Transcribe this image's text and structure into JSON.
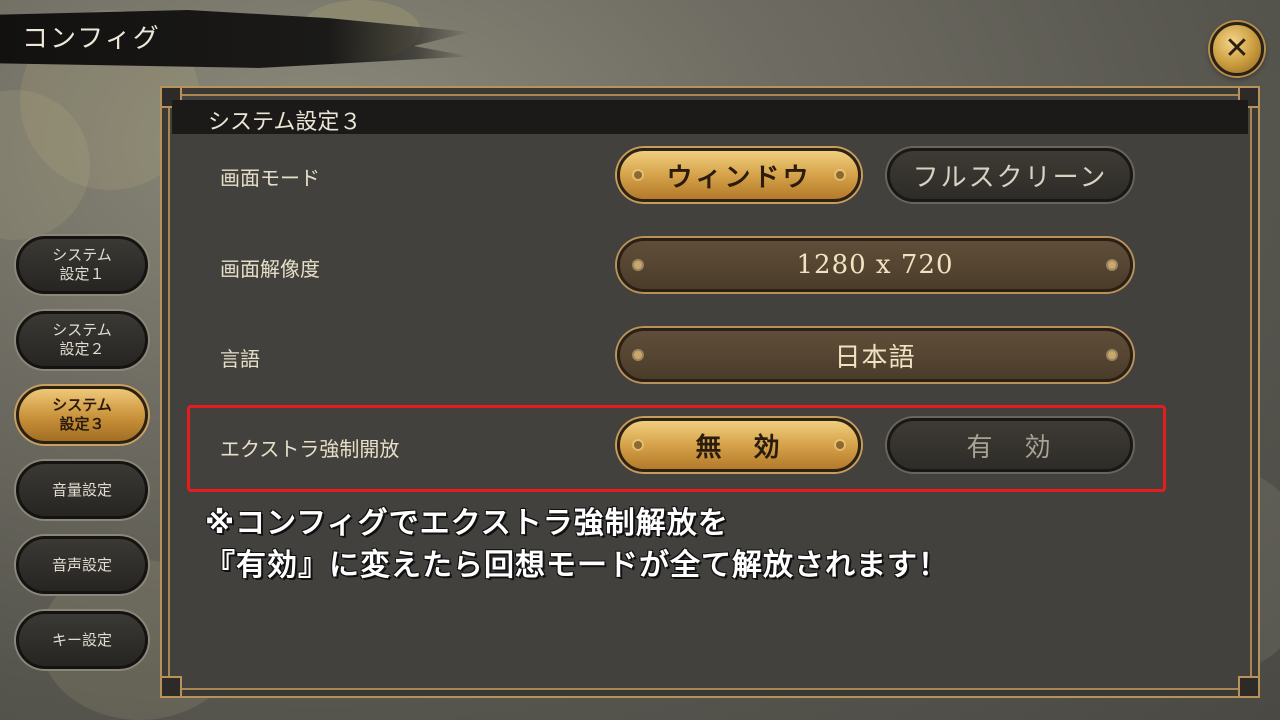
{
  "header": {
    "title": "コンフィグ",
    "close_icon": "close-x-icon"
  },
  "panel": {
    "title": "システム設定３"
  },
  "sidebar": {
    "items": [
      {
        "label_line1": "システム",
        "label_line2": "設定１",
        "active": false
      },
      {
        "label_line1": "システム",
        "label_line2": "設定２",
        "active": false
      },
      {
        "label_line1": "システム",
        "label_line2": "設定３",
        "active": true
      },
      {
        "label_line1": "音量設定",
        "label_line2": "",
        "active": false
      },
      {
        "label_line1": "音声設定",
        "label_line2": "",
        "active": false
      },
      {
        "label_line1": "キー設定",
        "label_line2": "",
        "active": false
      }
    ]
  },
  "settings": {
    "screen_mode": {
      "label": "画面モード",
      "option_window": "ウィンドウ",
      "option_fullscreen": "フルスクリーン",
      "selected": "ウィンドウ"
    },
    "resolution": {
      "label": "画面解像度",
      "value": "1280 x 720"
    },
    "language": {
      "label": "言語",
      "value": "日本語"
    },
    "extra_unlock": {
      "label": "エクストラ強制開放",
      "option_off": "無　効",
      "option_on": "有　効",
      "selected": "無　効"
    }
  },
  "annotation": {
    "line1": "※コンフィグでエクストラ強制解放を",
    "line2": "『有効』に変えたら回想モードが全て解放されます！",
    "box_color": "#e51d1d"
  },
  "colors": {
    "gold": "#d6a24a",
    "panel": "#43413d",
    "accent_border": "#b8925a"
  }
}
